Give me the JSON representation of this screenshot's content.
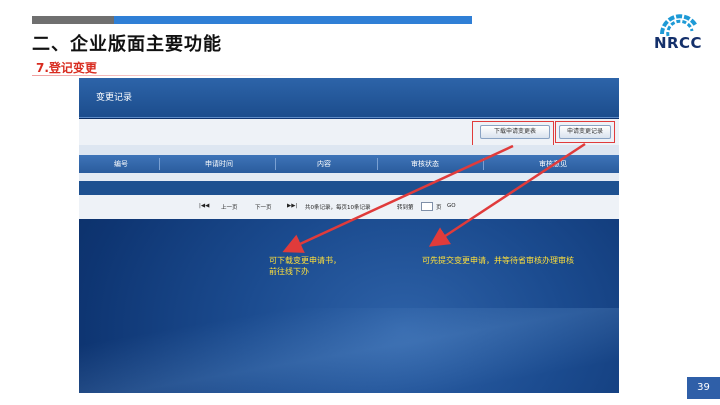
{
  "slide": {
    "title": "二、企业版面主要功能",
    "subtitle": "7.登记变更",
    "page_number": "39",
    "logo_text": "NRCC"
  },
  "screenshot": {
    "panel_title": "变更记录",
    "buttons": {
      "download": "下载申请变更表",
      "submit": "申请变更记录"
    },
    "table_headers": [
      "编号",
      "申请时间",
      "内容",
      "审核状态",
      "审核意见"
    ],
    "pager": {
      "first": "|◀◀",
      "prev": "上一页",
      "next": "下一页",
      "last": "▶▶|",
      "info": "共0条记录，每页10条记录",
      "goto_label": "转到第",
      "goto_suffix": "页",
      "go": "GO"
    },
    "callouts": {
      "left": [
        "可下载变更申请书，",
        "前往线下办"
      ],
      "right": "可先提交变更申请，并等待省审核办理审核"
    }
  },
  "colors": {
    "accent_blue": "#2f7fd6",
    "title_red": "#d82c20",
    "callout_yellow": "#ffe03a",
    "frame_red": "#e03b3b"
  }
}
